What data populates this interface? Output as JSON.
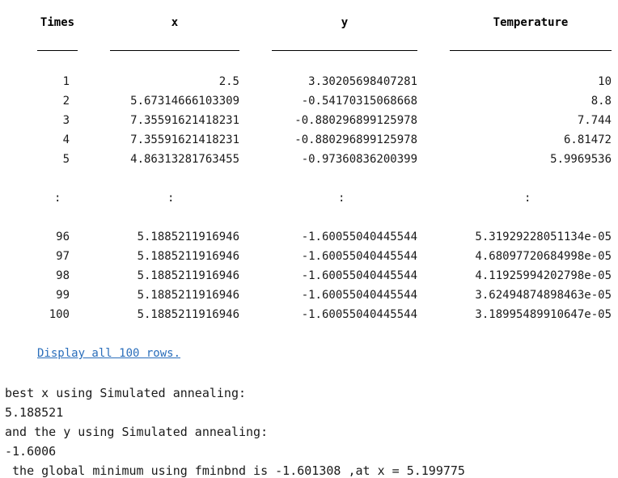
{
  "table": {
    "headers": [
      "Times",
      "x",
      "y",
      "Temperature"
    ],
    "rows_top": [
      [
        "1",
        "2.5",
        "3.30205698407281",
        "10"
      ],
      [
        "2",
        "5.67314666103309",
        "-0.54170315068668",
        "8.8"
      ],
      [
        "3",
        "7.35591621418231",
        "-0.880296899125978",
        "7.744"
      ],
      [
        "4",
        "7.35591621418231",
        "-0.880296899125978",
        "6.81472"
      ],
      [
        "5",
        "4.86313281763455",
        "-0.97360836200399",
        "5.9969536"
      ]
    ],
    "ellipsis": ":",
    "rows_bottom": [
      [
        "96",
        "5.1885211916946",
        "-1.60055040445544",
        "5.31929228051134e-05"
      ],
      [
        "97",
        "5.1885211916946",
        "-1.60055040445544",
        "4.68097720684998e-05"
      ],
      [
        "98",
        "5.1885211916946",
        "-1.60055040445544",
        "4.11925994202798e-05"
      ],
      [
        "99",
        "5.1885211916946",
        "-1.60055040445544",
        "3.62494874898463e-05"
      ],
      [
        "100",
        "5.1885211916946",
        "-1.60055040445544",
        "3.18995489910647e-05"
      ]
    ]
  },
  "display_all_link": "Display all 100 rows.",
  "output": {
    "line1": "best x using Simulated annealing:",
    "line2": "5.188521",
    "line3": "and the y using Simulated annealing:",
    "line4": "-1.6006",
    "line5": " the global minimum using fminbnd is -1.601308 ,at x = 5.199775"
  }
}
